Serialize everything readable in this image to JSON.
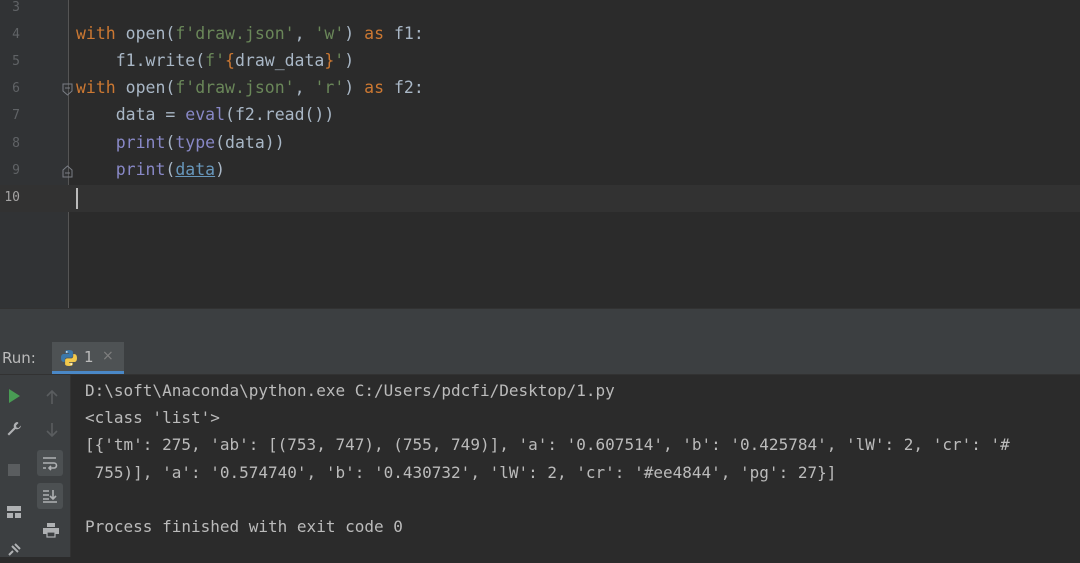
{
  "editor": {
    "lines": [
      {
        "num": "3"
      },
      {
        "num": "4",
        "parts": [
          "with",
          " open(",
          "f'draw.json'",
          ", ",
          "'w'",
          ") ",
          "as",
          " f1:"
        ]
      },
      {
        "num": "5",
        "parts": [
          "    f1.write(",
          "f'",
          "{",
          "draw_data",
          "}",
          "'",
          ")"
        ]
      },
      {
        "num": "6",
        "parts": [
          "with",
          " open(",
          "f'draw.json'",
          ", ",
          "'r'",
          ") ",
          "as",
          " f2:"
        ]
      },
      {
        "num": "7",
        "parts": [
          "    data = ",
          "eval",
          "(f2.read())"
        ]
      },
      {
        "num": "8",
        "parts": [
          "    ",
          "print",
          "(",
          "type",
          "(data))"
        ]
      },
      {
        "num": "9",
        "parts": [
          "    ",
          "print",
          "(",
          "data",
          ")"
        ]
      },
      {
        "num": "10"
      }
    ]
  },
  "run": {
    "label": "Run:",
    "tab_name": "1",
    "tab_close": "×"
  },
  "console": {
    "command": "D:\\soft\\Anaconda\\python.exe C:/Users/pdcfi/Desktop/1.py",
    "line1": "<class 'list'>",
    "line2": "[{'tm': 275, 'ab': [(753, 747), (755, 749)], 'a': '0.607514', 'b': '0.425784', 'lW': 2, 'cr': '#",
    "line3": " 755)], 'a': '0.574740', 'b': '0.430732', 'lW': 2, 'cr': '#ee4844', 'pg': 27}]",
    "line4": "Process finished with exit code 0"
  },
  "colors": {
    "keyword": "#cc7832",
    "builtin": "#8888c6",
    "string": "#6a8759",
    "tab_underline": "#4a88c7",
    "run_green": "#499c54"
  }
}
